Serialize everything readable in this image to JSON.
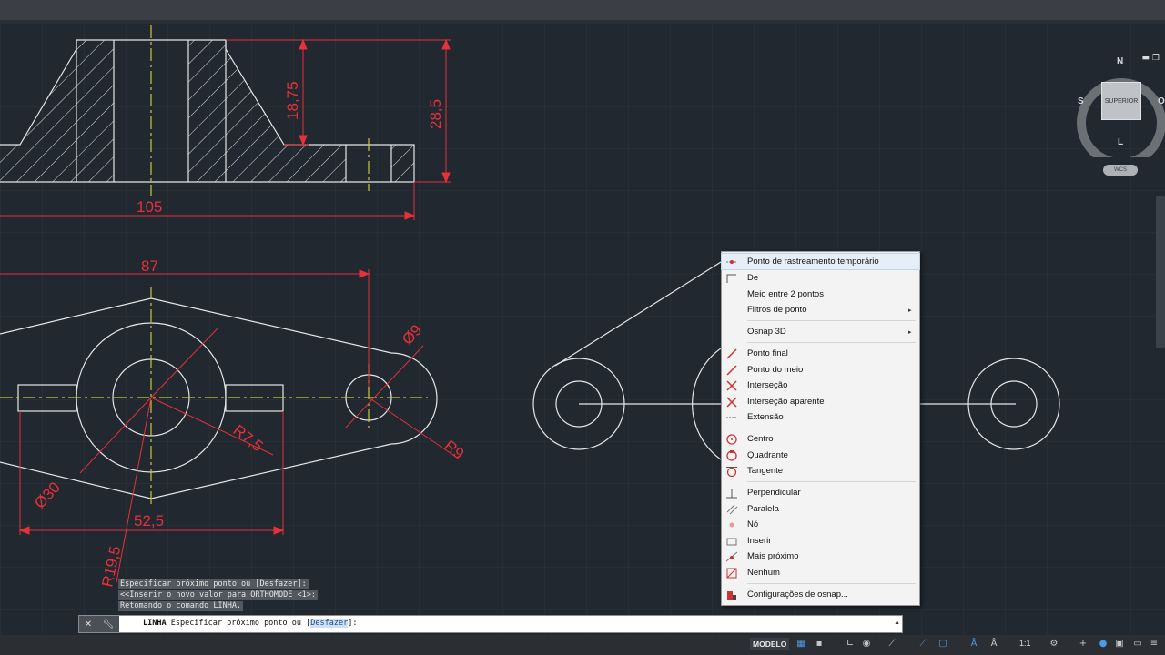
{
  "colors": {
    "background": "#212830",
    "dimension": "#e8303a",
    "centerline": "#c9c93a",
    "geometry": "#e6e6e6",
    "menu_bg": "#f3f3f3"
  },
  "drawing": {
    "dimensions": [
      "18,75",
      "28,5",
      "105",
      "87",
      "Ø9",
      "R7,5",
      "R9",
      "Ø30",
      "52,5",
      "R19,5"
    ]
  },
  "viewcube": {
    "face": "SUPERIOR",
    "north": "N",
    "south": "S",
    "east": "L",
    "west": "O",
    "wcs": "WCS"
  },
  "context_menu": {
    "items": [
      {
        "label": "Ponto de rastreamento temporário",
        "icon": "tracking-point-icon"
      },
      {
        "label": "De",
        "icon": "from-icon"
      },
      {
        "label": "Meio entre 2 pontos",
        "icon": ""
      },
      {
        "label": "Filtros de ponto",
        "icon": "",
        "submenu": "▸"
      },
      {
        "label": "Osnap 3D",
        "icon": "",
        "submenu": "▸"
      },
      {
        "label": "Ponto final",
        "icon": "endpoint-icon"
      },
      {
        "label": "Ponto do meio",
        "icon": "midpoint-icon"
      },
      {
        "label": "Interseção",
        "icon": "intersection-icon"
      },
      {
        "label": "Interseção aparente",
        "icon": "apparent-intersection-icon"
      },
      {
        "label": "Extensão",
        "icon": "extension-icon"
      },
      {
        "label": "Centro",
        "icon": "center-icon"
      },
      {
        "label": "Quadrante",
        "icon": "quadrant-icon"
      },
      {
        "label": "Tangente",
        "icon": "tangent-icon"
      },
      {
        "label": "Perpendicular",
        "icon": "perpendicular-icon"
      },
      {
        "label": "Paralela",
        "icon": "parallel-icon"
      },
      {
        "label": "Nó",
        "icon": "node-icon"
      },
      {
        "label": "Inserir",
        "icon": "insert-icon"
      },
      {
        "label": "Mais próximo",
        "icon": "nearest-icon"
      },
      {
        "label": "Nenhum",
        "icon": "none-icon"
      },
      {
        "label": "Configurações de osnap...",
        "icon": "osnap-settings-icon"
      }
    ]
  },
  "command_history": [
    "Especificar próximo ponto ou [Desfazer]:",
    "<<Inserir o novo valor para ORTHOMODE <1>:",
    "Retomando o comando LINHA."
  ],
  "command_line": {
    "prefix": "LINHA",
    "prompt": "Especificar próximo ponto ou [",
    "option": "Desfazer",
    "suffix": "]:"
  },
  "status_bar": {
    "model_tab": "MODELO",
    "scale": "1:1"
  }
}
